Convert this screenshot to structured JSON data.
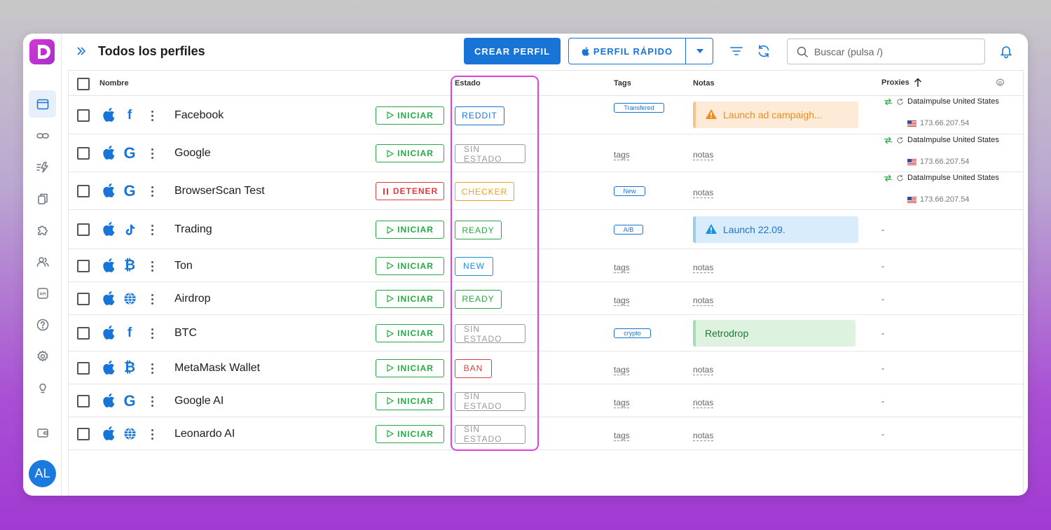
{
  "header": {
    "title": "Todos los perfiles",
    "create_label": "CREAR PERFIL",
    "quick_label": "PERFIL RÁPIDO",
    "search_placeholder": "Buscar (pulsa /)"
  },
  "sidebar": {
    "avatar_initials": "AL",
    "items": [
      "profiles",
      "links",
      "automation",
      "copy",
      "extensions",
      "team",
      "api",
      "help",
      "settings",
      "tips",
      "wallet"
    ]
  },
  "columns": {
    "name": "Nombre",
    "status": "Estado",
    "tags": "Tags",
    "notes": "Notas",
    "proxies": "Proxies"
  },
  "rows": [
    {
      "name": "Facebook",
      "site_icon": "facebook-icon",
      "action": "INICIAR",
      "status": "REDDIT",
      "status_color": "#1874d6",
      "tag": "Transfered",
      "note": "Launch ad campaigh...",
      "note_type": "warning",
      "proxy": "DataImpulse United States",
      "ip": "173.66.207.54"
    },
    {
      "name": "Google",
      "site_icon": "google-icon",
      "action": "INICIAR",
      "status": "SIN ESTADO",
      "status_color": "#999999",
      "tag_placeholder": "tags",
      "note_placeholder": "notas",
      "proxy": "DataImpulse United States",
      "ip": "173.66.207.54"
    },
    {
      "name": "BrowserScan Test",
      "site_icon": "google-icon",
      "action": "DETENER",
      "status": "CHECKER",
      "status_color": "#f0a020",
      "tag": "New",
      "note_placeholder": "notas",
      "proxy": "DataImpulse United States",
      "ip": "173.66.207.54"
    },
    {
      "name": "Trading",
      "site_icon": "tiktok-icon",
      "action": "INICIAR",
      "status": "READY",
      "status_color": "#27a844",
      "tag": "A/B",
      "note": "Launch 22.09.",
      "note_type": "info",
      "proxy": "-"
    },
    {
      "name": "Ton",
      "site_icon": "bitcoin-icon",
      "action": "INICIAR",
      "status": "NEW",
      "status_color": "#1a90d6",
      "tag_placeholder": "tags",
      "note_placeholder": "notas",
      "proxy": "-"
    },
    {
      "name": "Airdrop",
      "site_icon": "globe-icon",
      "action": "INICIAR",
      "status": "READY",
      "status_color": "#27a844",
      "tag_placeholder": "tags",
      "note_placeholder": "notas",
      "proxy": "-"
    },
    {
      "name": "BTC",
      "site_icon": "facebook-icon",
      "action": "INICIAR",
      "status": "SIN ESTADO",
      "status_color": "#999999",
      "tag": "crypto",
      "note": "Retrodrop",
      "note_type": "success",
      "proxy": "-"
    },
    {
      "name": "MetaMask Wallet",
      "site_icon": "bitcoin-icon",
      "action": "INICIAR",
      "status": "BAN",
      "status_color": "#e03c3c",
      "tag_placeholder": "tags",
      "note_placeholder": "notas",
      "proxy": "-"
    },
    {
      "name": "Google AI",
      "site_icon": "google-icon",
      "action": "INICIAR",
      "status": "SIN ESTADO",
      "status_color": "#999999",
      "tag_placeholder": "tags",
      "note_placeholder": "notas",
      "proxy": "-"
    },
    {
      "name": "Leonardo AI",
      "site_icon": "globe-icon",
      "action": "INICIAR",
      "status": "SIN ESTADO",
      "status_color": "#999999",
      "tag_placeholder": "tags",
      "note_placeholder": "notas",
      "proxy": "-"
    }
  ],
  "colors": {
    "accent": "#1874d6",
    "success": "#27a844",
    "danger": "#e03c3c",
    "warning": "#f0a020",
    "highlight": "#e040e0"
  }
}
